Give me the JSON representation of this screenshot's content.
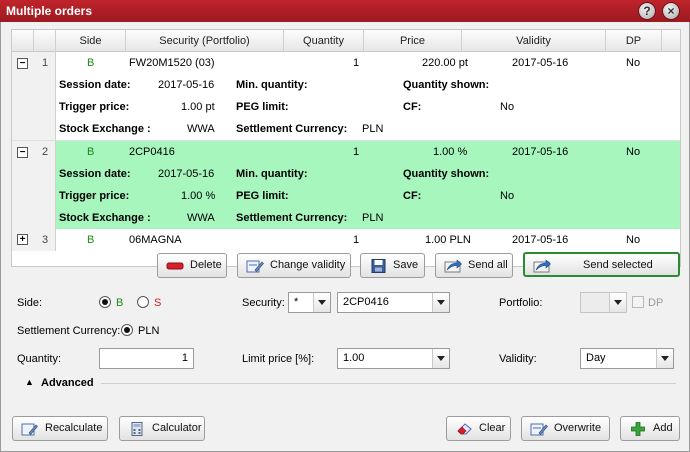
{
  "window": {
    "title": "Multiple orders",
    "help_label": "?",
    "close_label": "×"
  },
  "grid": {
    "headers": [
      "Side",
      "Security (Portfolio)",
      "Quantity",
      "Price",
      "Validity",
      "DP"
    ],
    "rows": [
      {
        "num": "1",
        "side": "B",
        "security": "FW20M1520 (03)",
        "quantity": "1",
        "price": "220.00 pt",
        "validity": "2017-05-16",
        "dp": "No",
        "toggle": "−",
        "session_date_label": "Session date:",
        "session_date": "2017-05-16",
        "min_qty_label": "Min. quantity:",
        "qty_shown_label": "Quantity shown:",
        "trigger_label": "Trigger price:",
        "trigger": "1.00 pt",
        "peg_label": "PEG limit:",
        "cf_label": "CF:",
        "cf": "No",
        "exchange_label": "Stock Exchange :",
        "exchange": "WWA",
        "settle_label": "Settlement Currency:",
        "settle": "PLN"
      },
      {
        "num": "2",
        "side": "B",
        "security": "2CP0416",
        "quantity": "1",
        "price": "1.00 %",
        "validity": "2017-05-16",
        "dp": "No",
        "toggle": "−",
        "session_date_label": "Session date:",
        "session_date": "2017-05-16",
        "min_qty_label": "Min. quantity:",
        "qty_shown_label": "Quantity shown:",
        "trigger_label": "Trigger price:",
        "trigger": "1.00 %",
        "peg_label": "PEG limit:",
        "cf_label": "CF:",
        "cf": "No",
        "exchange_label": "Stock Exchange :",
        "exchange": "WWA",
        "settle_label": "Settlement Currency:",
        "settle": "PLN"
      },
      {
        "num": "3",
        "side": "B",
        "security": "06MAGNA",
        "quantity": "1",
        "price": "1.00 PLN",
        "validity": "2017-05-16",
        "dp": "No",
        "toggle": "+"
      }
    ]
  },
  "actions": {
    "delete": "Delete",
    "change_validity": "Change validity",
    "save": "Save",
    "send_all": "Send all",
    "send_selected": "Send selected"
  },
  "form": {
    "side_label": "Side:",
    "side_buy": "B",
    "side_sell": "S",
    "security_label": "Security:",
    "security_prefix": "*",
    "security_value": "2CP0416",
    "portfolio_label": "Portfolio:",
    "portfolio_value": "",
    "dp_label": "DP",
    "settlement_label": "Settlement Currency:",
    "settlement_value": "PLN",
    "quantity_label": "Quantity:",
    "quantity_value": "1",
    "limit_label": "Limit price [%]:",
    "limit_value": "1.00",
    "validity_label": "Validity:",
    "validity_value": "Day",
    "advanced_label": "Advanced"
  },
  "footer": {
    "recalculate": "Recalculate",
    "calculator": "Calculator",
    "clear": "Clear",
    "overwrite": "Overwrite",
    "add": "Add"
  }
}
